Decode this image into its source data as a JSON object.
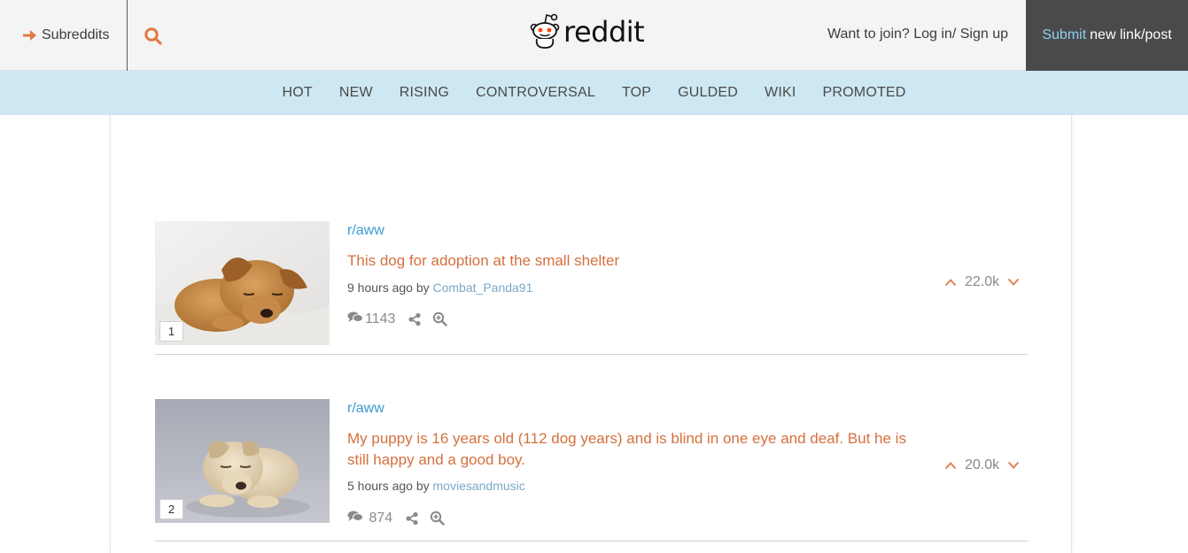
{
  "header": {
    "subreddits_label": "Subreddits",
    "logo_text": "reddit",
    "join_text": "Want to join? Log in/ Sign up",
    "submit_accent": "Submit",
    "submit_rest": "new link/post"
  },
  "nav": {
    "items": [
      "HOT",
      "NEW",
      "RISING",
      "CONTROVERSAL",
      "TOP",
      "GULDED",
      "WIKI",
      "PROMOTED"
    ]
  },
  "posts": [
    {
      "rank": "1",
      "subreddit": "r/aww",
      "title": "This dog for adoption at the small shelter",
      "time": "9 hours ago by",
      "author": "Combat_Panda91",
      "comments": "1143",
      "score": "22.0k"
    },
    {
      "rank": "2",
      "subreddit": "r/aww",
      "title": "My puppy is 16 years old (112 dog years) and is blind in one eye and deaf. But he is still happy and a good boy.",
      "time": "5 hours ago by",
      "author": "moviesandmusic",
      "comments": " 874",
      "score": "20.0k"
    }
  ],
  "colors": {
    "accent": "#d4703e",
    "link": "#3d9ad1",
    "nav_bg": "#cde8f3",
    "header_bg": "#f4f4f4",
    "submit_bg": "#4a4a4a"
  },
  "icons": [
    "arrow-right-icon",
    "search-icon",
    "reddit-alien-icon",
    "comments-icon",
    "share-icon",
    "zoom-icon",
    "upvote-icon",
    "downvote-icon"
  ]
}
